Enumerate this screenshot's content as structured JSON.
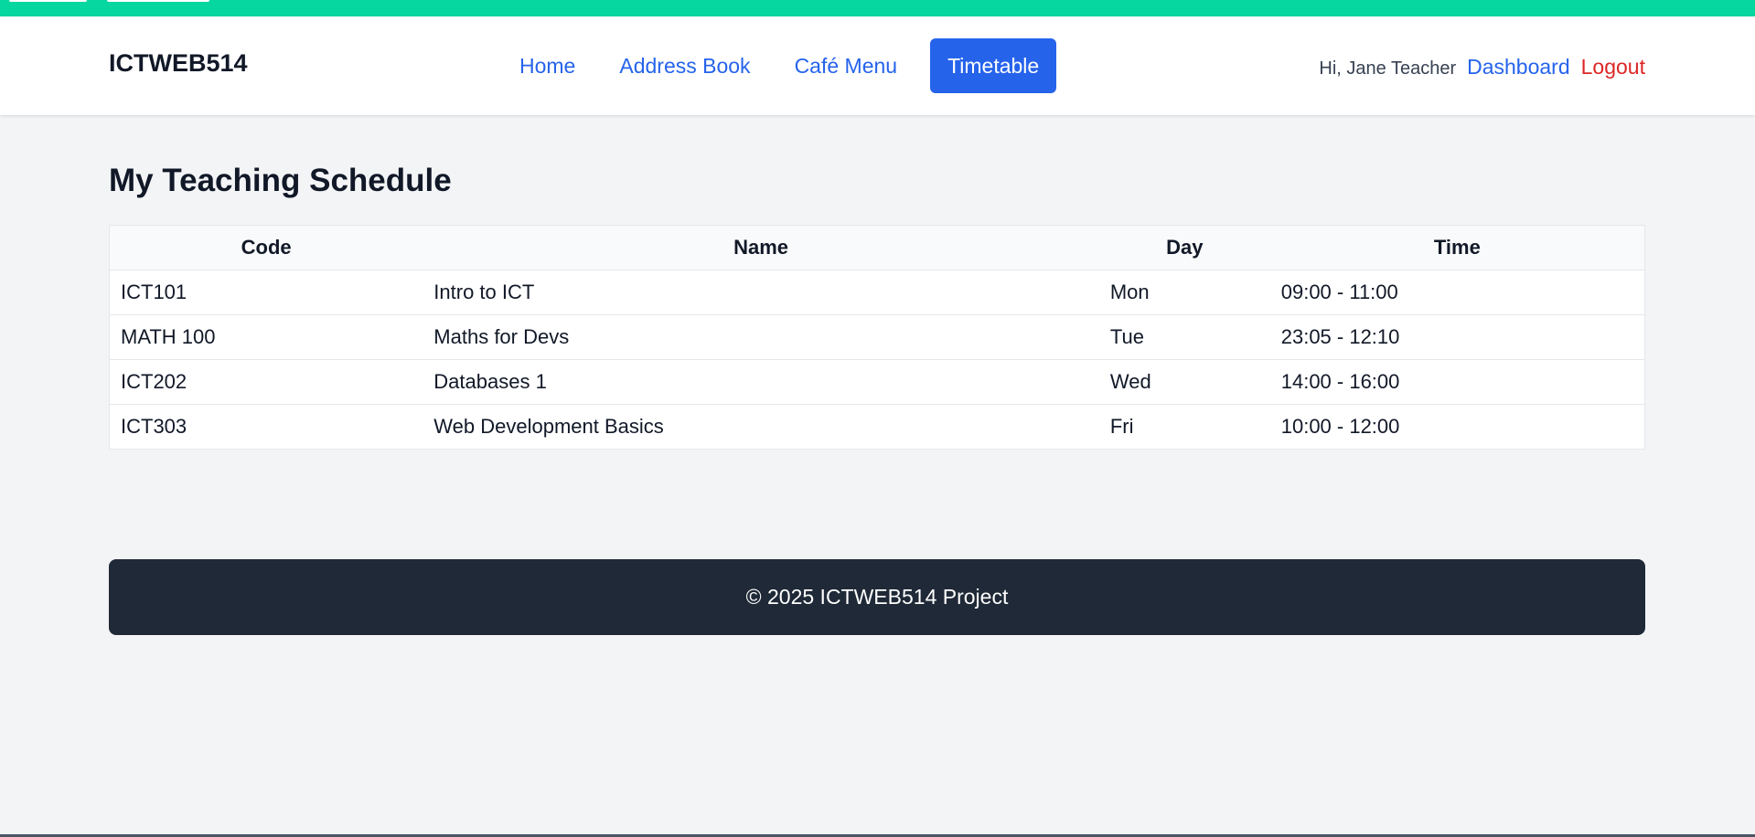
{
  "brand": "ICTWEB514",
  "nav": {
    "links": [
      {
        "label": "Home"
      },
      {
        "label": "Address Book"
      },
      {
        "label": "Café Menu"
      },
      {
        "label": "Timetable",
        "active": true
      }
    ]
  },
  "user": {
    "greeting": "Hi, Jane Teacher",
    "dashboard": "Dashboard",
    "logout": "Logout"
  },
  "main": {
    "title": "My Teaching Schedule",
    "table": {
      "headers": [
        "Code",
        "Name",
        "Day",
        "Time"
      ],
      "rows": [
        [
          "ICT101",
          "Intro to ICT",
          "Mon",
          "09:00 - 11:00"
        ],
        [
          "MATH 100",
          "Maths for Devs",
          "Tue",
          "23:05 - 12:10"
        ],
        [
          "ICT202",
          "Databases 1",
          "Wed",
          "14:00 - 16:00"
        ],
        [
          "ICT303",
          "Web Development Basics",
          "Fri",
          "10:00 - 12:00"
        ]
      ]
    }
  },
  "footer": {
    "text": "© 2025 ICTWEB514 Project"
  },
  "colors": {
    "accent_bar": "#06d6a0",
    "primary": "#2563eb",
    "danger": "#dc2626",
    "footer_bg": "#1f2937"
  }
}
